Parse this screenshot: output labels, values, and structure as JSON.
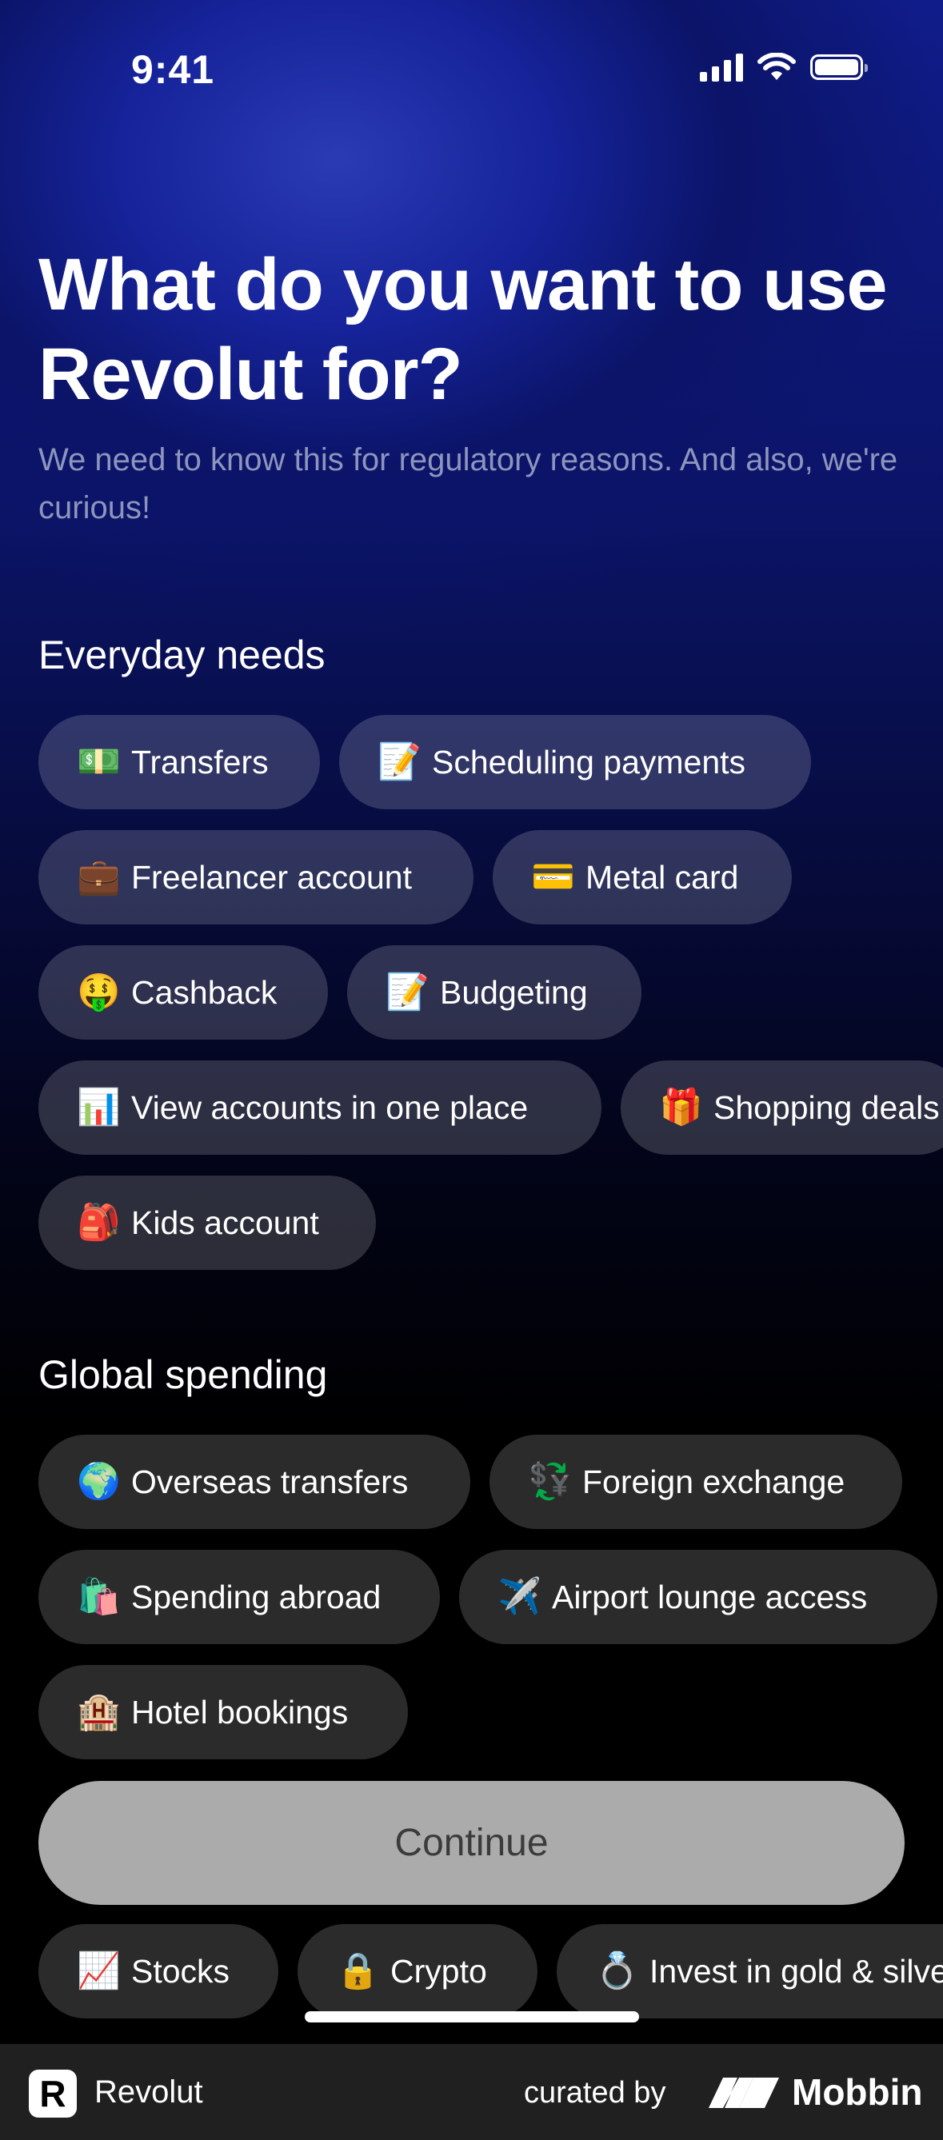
{
  "status": {
    "time": "9:41"
  },
  "header": {
    "title": "What do you want to use Revolut for?",
    "subtitle": "We need to know this for regulatory reasons. And also, we're curious!"
  },
  "sections": [
    {
      "title": "Everyday needs",
      "chips": [
        {
          "emoji": "💵",
          "label": "Transfers"
        },
        {
          "emoji": "📝",
          "label": "Scheduling payments"
        },
        {
          "emoji": "💼",
          "label": "Freelancer account"
        },
        {
          "emoji": "💳",
          "label": "Metal card"
        },
        {
          "emoji": "🤑",
          "label": "Cashback"
        },
        {
          "emoji": "📝",
          "label": "Budgeting"
        },
        {
          "emoji": "📊",
          "label": "View accounts in one place"
        },
        {
          "emoji": "🎁",
          "label": "Shopping deals"
        },
        {
          "emoji": "🎒",
          "label": "Kids account"
        }
      ]
    },
    {
      "title": "Global spending",
      "chips": [
        {
          "emoji": "🌍",
          "label": "Overseas transfers"
        },
        {
          "emoji": "💱",
          "label": "Foreign exchange"
        },
        {
          "emoji": "🛍️",
          "label": "Spending abroad"
        },
        {
          "emoji": "✈️",
          "label": "Airport lounge access"
        },
        {
          "emoji": "🏨",
          "label": "Hotel bookings"
        }
      ]
    },
    {
      "title": "",
      "chips": [
        {
          "emoji": "📈",
          "label": "Stocks"
        },
        {
          "emoji": "🔒",
          "label": "Crypto"
        },
        {
          "emoji": "💍",
          "label": "Invest in gold & silver"
        }
      ]
    }
  ],
  "continue_label": "Continue",
  "footer": {
    "app_name": "Revolut",
    "logo_letter": "R",
    "curated_by": "curated by",
    "brand": "Mobbin"
  }
}
